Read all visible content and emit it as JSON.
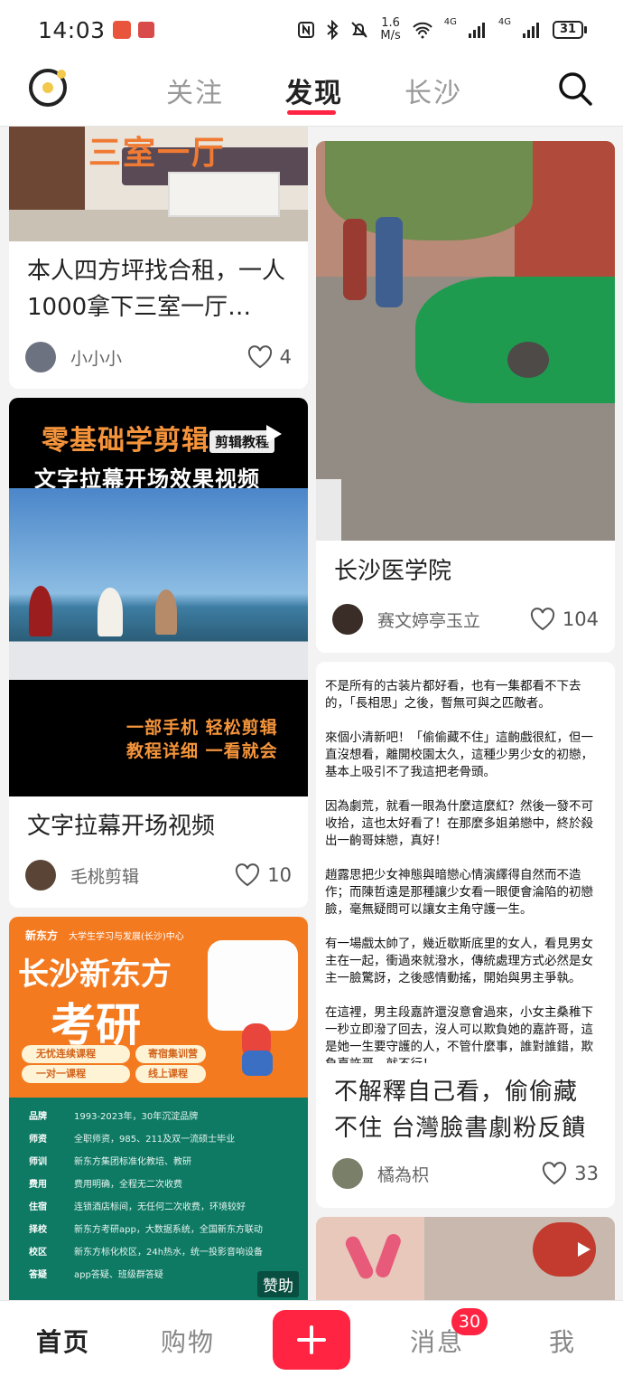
{
  "status_bar": {
    "time": "14:03",
    "speed_value": "1.6",
    "speed_unit": "M/s",
    "signal_1": "4G",
    "signal_2": "4G",
    "battery": "31"
  },
  "header": {
    "tabs": [
      {
        "label": "关注"
      },
      {
        "label": "发现",
        "active": true
      },
      {
        "label": "长沙"
      }
    ]
  },
  "feed": {
    "left": [
      {
        "image_text": "三室一厅",
        "title": "本人四方坪找合租，一人1000拿下三室一厅…",
        "author": "小小小",
        "likes": "4"
      },
      {
        "image_text_1": "零基础学剪辑",
        "image_tag": "剪辑教程",
        "image_text_2": "文字拉幕开场效果视频",
        "image_text_3": "一部手机  轻松剪辑",
        "image_text_4": "教程详细  一看就会",
        "title": "文字拉幕开场视频",
        "author": "毛桃剪辑",
        "likes": "10"
      },
      {
        "brand": "新东方",
        "center_line": "大学生学习与发展(长沙)中心",
        "headline_1": "长沙新东方",
        "headline_2": "考研",
        "chips": [
          "无忧连续课程",
          "寄宿集训营",
          "一对一课程",
          "线上课程"
        ],
        "rows": [
          {
            "k": "品牌",
            "v": "1993-2023年，30年沉淀品牌"
          },
          {
            "k": "师资",
            "v": "全职师资，985、211及双一流硕士毕业"
          },
          {
            "k": "师训",
            "v": "新东方集团标准化教培、教研"
          },
          {
            "k": "费用",
            "v": "费用明确，全程无二次收费"
          },
          {
            "k": "住宿",
            "v": "连锁酒店标间，无任何二次收费，环境较好"
          },
          {
            "k": "择校",
            "v": "新东方考研app，大数据系统，全国新东方联动"
          },
          {
            "k": "校区",
            "v": "新东方标化校区，24h热水，统一投影音响设备"
          },
          {
            "k": "答疑",
            "v": "app答疑、班级群答疑"
          }
        ],
        "sponsor": "赞助"
      }
    ],
    "right": [
      {
        "title": "长沙医学院",
        "author": "赛文婷亭玉立",
        "likes": "104"
      },
      {
        "preview_paragraphs": [
          "不是所有的古装片都好看，也有一集都看不下去的，「長相思」之後，暫無可與之匹敵者。",
          "來個小清新吧！「偷偷藏不住」這齣戲很紅，但一直沒想看，離開校園太久，這種少男少女的初戀，基本上吸引不了我這把老骨頭。",
          "因為劇荒，就看一眼為什麼這麼紅？然後一發不可收拾，這也太好看了！在那麼多姐弟戀中，終於殺出一齣哥妹戀，真好！",
          "趙露思把少女神態與暗戀心情演繹得自然而不造作；而陳哲遠是那種讓少女看一眼便會淪陷的初戀臉，毫無疑問可以讓女主角守護一生。",
          "有一場戲太帥了，幾近歇斯底里的女人，看見男女主在一起，衝過來就潑水，傳統處理方式必然是女主一臉驚訝，之後感情動搖，開始與男主爭執。",
          "在這裡，男主段嘉許還沒意會過來，小女主桑稚下一秒立即潑了回去，沒人可以欺負她的嘉許哥，這是她一生要守護的人，不管什麼事，誰對誰錯，欺負嘉許哥，就不行！"
        ],
        "title": "不解釋自己看，偷偷藏不住 台灣臉書劇粉反饋",
        "author": "橘為枳",
        "likes": "33"
      },
      {}
    ]
  },
  "bottom_nav": {
    "items": [
      {
        "label": "首页",
        "active": true
      },
      {
        "label": "购物"
      },
      {
        "label": "消息",
        "badge": "30"
      },
      {
        "label": "我"
      }
    ]
  },
  "colors": {
    "accent": "#ff2442",
    "logo_yellow": "#f2c94c",
    "ad_orange": "#f47a20",
    "ad_green": "#0e7a64"
  },
  "icons": [
    "logo-icon",
    "search-icon",
    "heart-icon",
    "plus-icon",
    "play-icon",
    "nfc-icon",
    "bluetooth-icon",
    "mute-icon",
    "wifi-icon",
    "signal-icon",
    "battery-icon"
  ]
}
